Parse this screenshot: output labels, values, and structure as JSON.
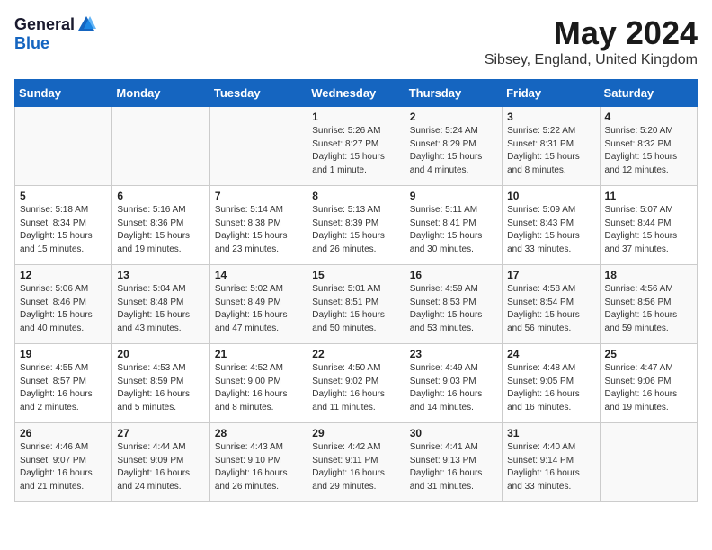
{
  "header": {
    "logo_general": "General",
    "logo_blue": "Blue",
    "month_title": "May 2024",
    "location": "Sibsey, England, United Kingdom"
  },
  "columns": [
    "Sunday",
    "Monday",
    "Tuesday",
    "Wednesday",
    "Thursday",
    "Friday",
    "Saturday"
  ],
  "weeks": [
    [
      {
        "day": "",
        "info": ""
      },
      {
        "day": "",
        "info": ""
      },
      {
        "day": "",
        "info": ""
      },
      {
        "day": "1",
        "info": "Sunrise: 5:26 AM\nSunset: 8:27 PM\nDaylight: 15 hours\nand 1 minute."
      },
      {
        "day": "2",
        "info": "Sunrise: 5:24 AM\nSunset: 8:29 PM\nDaylight: 15 hours\nand 4 minutes."
      },
      {
        "day": "3",
        "info": "Sunrise: 5:22 AM\nSunset: 8:31 PM\nDaylight: 15 hours\nand 8 minutes."
      },
      {
        "day": "4",
        "info": "Sunrise: 5:20 AM\nSunset: 8:32 PM\nDaylight: 15 hours\nand 12 minutes."
      }
    ],
    [
      {
        "day": "5",
        "info": "Sunrise: 5:18 AM\nSunset: 8:34 PM\nDaylight: 15 hours\nand 15 minutes."
      },
      {
        "day": "6",
        "info": "Sunrise: 5:16 AM\nSunset: 8:36 PM\nDaylight: 15 hours\nand 19 minutes."
      },
      {
        "day": "7",
        "info": "Sunrise: 5:14 AM\nSunset: 8:38 PM\nDaylight: 15 hours\nand 23 minutes."
      },
      {
        "day": "8",
        "info": "Sunrise: 5:13 AM\nSunset: 8:39 PM\nDaylight: 15 hours\nand 26 minutes."
      },
      {
        "day": "9",
        "info": "Sunrise: 5:11 AM\nSunset: 8:41 PM\nDaylight: 15 hours\nand 30 minutes."
      },
      {
        "day": "10",
        "info": "Sunrise: 5:09 AM\nSunset: 8:43 PM\nDaylight: 15 hours\nand 33 minutes."
      },
      {
        "day": "11",
        "info": "Sunrise: 5:07 AM\nSunset: 8:44 PM\nDaylight: 15 hours\nand 37 minutes."
      }
    ],
    [
      {
        "day": "12",
        "info": "Sunrise: 5:06 AM\nSunset: 8:46 PM\nDaylight: 15 hours\nand 40 minutes."
      },
      {
        "day": "13",
        "info": "Sunrise: 5:04 AM\nSunset: 8:48 PM\nDaylight: 15 hours\nand 43 minutes."
      },
      {
        "day": "14",
        "info": "Sunrise: 5:02 AM\nSunset: 8:49 PM\nDaylight: 15 hours\nand 47 minutes."
      },
      {
        "day": "15",
        "info": "Sunrise: 5:01 AM\nSunset: 8:51 PM\nDaylight: 15 hours\nand 50 minutes."
      },
      {
        "day": "16",
        "info": "Sunrise: 4:59 AM\nSunset: 8:53 PM\nDaylight: 15 hours\nand 53 minutes."
      },
      {
        "day": "17",
        "info": "Sunrise: 4:58 AM\nSunset: 8:54 PM\nDaylight: 15 hours\nand 56 minutes."
      },
      {
        "day": "18",
        "info": "Sunrise: 4:56 AM\nSunset: 8:56 PM\nDaylight: 15 hours\nand 59 minutes."
      }
    ],
    [
      {
        "day": "19",
        "info": "Sunrise: 4:55 AM\nSunset: 8:57 PM\nDaylight: 16 hours\nand 2 minutes."
      },
      {
        "day": "20",
        "info": "Sunrise: 4:53 AM\nSunset: 8:59 PM\nDaylight: 16 hours\nand 5 minutes."
      },
      {
        "day": "21",
        "info": "Sunrise: 4:52 AM\nSunset: 9:00 PM\nDaylight: 16 hours\nand 8 minutes."
      },
      {
        "day": "22",
        "info": "Sunrise: 4:50 AM\nSunset: 9:02 PM\nDaylight: 16 hours\nand 11 minutes."
      },
      {
        "day": "23",
        "info": "Sunrise: 4:49 AM\nSunset: 9:03 PM\nDaylight: 16 hours\nand 14 minutes."
      },
      {
        "day": "24",
        "info": "Sunrise: 4:48 AM\nSunset: 9:05 PM\nDaylight: 16 hours\nand 16 minutes."
      },
      {
        "day": "25",
        "info": "Sunrise: 4:47 AM\nSunset: 9:06 PM\nDaylight: 16 hours\nand 19 minutes."
      }
    ],
    [
      {
        "day": "26",
        "info": "Sunrise: 4:46 AM\nSunset: 9:07 PM\nDaylight: 16 hours\nand 21 minutes."
      },
      {
        "day": "27",
        "info": "Sunrise: 4:44 AM\nSunset: 9:09 PM\nDaylight: 16 hours\nand 24 minutes."
      },
      {
        "day": "28",
        "info": "Sunrise: 4:43 AM\nSunset: 9:10 PM\nDaylight: 16 hours\nand 26 minutes."
      },
      {
        "day": "29",
        "info": "Sunrise: 4:42 AM\nSunset: 9:11 PM\nDaylight: 16 hours\nand 29 minutes."
      },
      {
        "day": "30",
        "info": "Sunrise: 4:41 AM\nSunset: 9:13 PM\nDaylight: 16 hours\nand 31 minutes."
      },
      {
        "day": "31",
        "info": "Sunrise: 4:40 AM\nSunset: 9:14 PM\nDaylight: 16 hours\nand 33 minutes."
      },
      {
        "day": "",
        "info": ""
      }
    ]
  ]
}
